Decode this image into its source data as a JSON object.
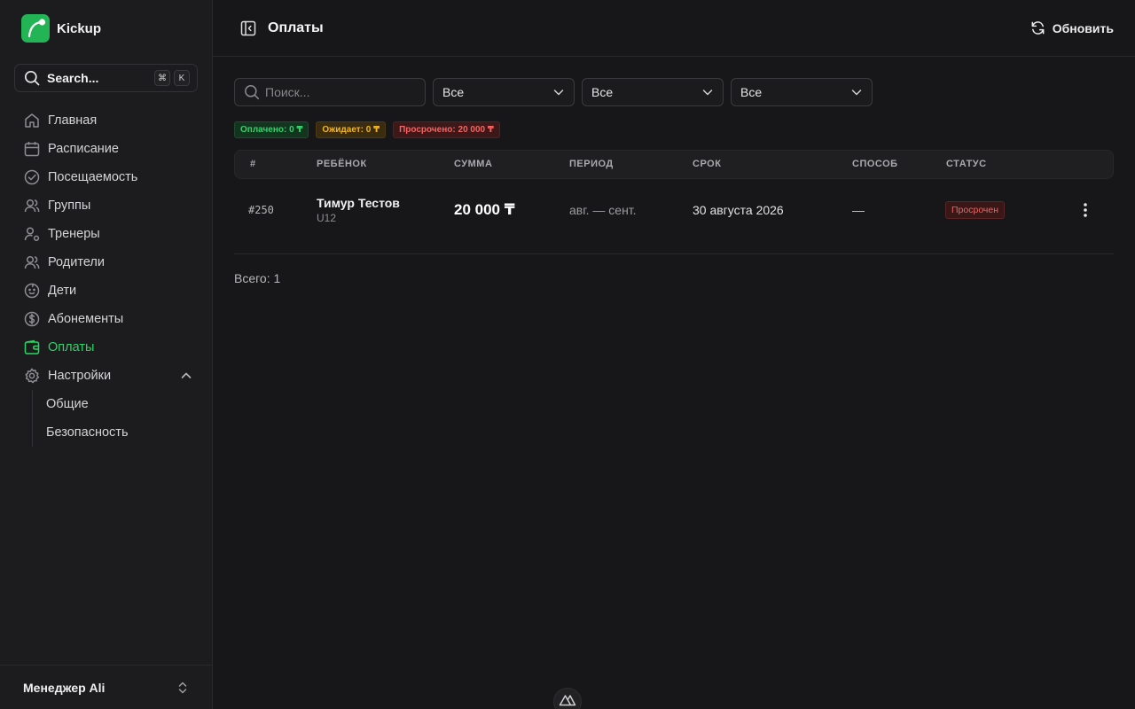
{
  "brand": {
    "name": "Kickup",
    "accent": "#22b455"
  },
  "search": {
    "label": "Search...",
    "kbd": [
      "⌘",
      "K"
    ]
  },
  "nav": {
    "items": [
      {
        "label": "Главная",
        "icon": "home-icon"
      },
      {
        "label": "Расписание",
        "icon": "calendar-icon"
      },
      {
        "label": "Посещаемость",
        "icon": "check-circle-icon"
      },
      {
        "label": "Группы",
        "icon": "users-icon"
      },
      {
        "label": "Тренеры",
        "icon": "user-cog-icon"
      },
      {
        "label": "Родители",
        "icon": "users-icon"
      },
      {
        "label": "Дети",
        "icon": "baby-icon"
      },
      {
        "label": "Абонементы",
        "icon": "dollar-circle-icon"
      },
      {
        "label": "Оплаты",
        "icon": "wallet-icon",
        "active": true
      },
      {
        "label": "Настройки",
        "icon": "gear-icon",
        "expanded": true
      }
    ],
    "settings_sub": [
      {
        "label": "Общие"
      },
      {
        "label": "Безопасность"
      }
    ]
  },
  "user": {
    "name": "Менеджер Ali"
  },
  "header": {
    "title": "Оплаты",
    "refresh_label": "Обновить"
  },
  "filters": {
    "search_placeholder": "Поиск...",
    "selects": [
      "Все",
      "Все",
      "Все"
    ]
  },
  "summary": {
    "paid": "Оплачено: 0 ₸",
    "pending": "Ожидает: 0 ₸",
    "overdue": "Просрочено: 20 000 ₸"
  },
  "table": {
    "columns": [
      "#",
      "РЕБЁНОК",
      "СУММА",
      "ПЕРИОД",
      "СРОК",
      "СПОСОБ",
      "СТАТУС"
    ],
    "rows": [
      {
        "id": "#250",
        "child": "Тимур Тестов",
        "group": "U12",
        "amount": "20 000 ₸",
        "period": "авг. — сент.",
        "due": "30 августа 2026",
        "method": "—",
        "status": "Просрочен"
      }
    ]
  },
  "total": "Всего: 1",
  "colors": {
    "paid": "#37d06c",
    "pending": "#f0b529",
    "overdue": "#f06464"
  }
}
